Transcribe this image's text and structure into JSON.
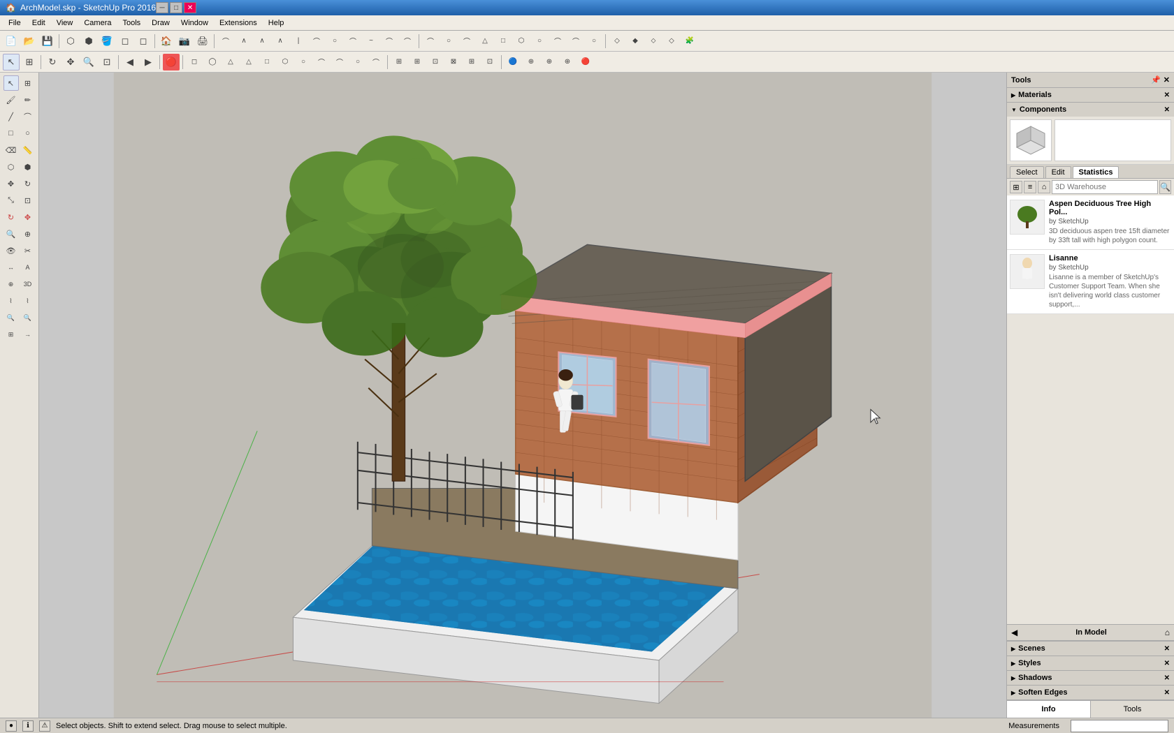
{
  "titlebar": {
    "title": "ArchModel.skp - SketchUp Pro 2016",
    "controls": [
      "minimize",
      "maximize",
      "close"
    ]
  },
  "menubar": {
    "items": [
      "File",
      "Edit",
      "View",
      "Camera",
      "Tools",
      "Draw",
      "Window",
      "Extensions",
      "Help"
    ]
  },
  "panels": {
    "tools_label": "Tools",
    "materials_label": "Materials",
    "components_label": "Components",
    "scenes_label": "Scenes",
    "styles_label": "Styles",
    "shadows_label": "Shadows",
    "soften_edges_label": "Soften Edges"
  },
  "components": {
    "tabs": {
      "select_label": "Select",
      "edit_label": "Edit",
      "statistics_label": "Statistics"
    },
    "search_placeholder": "3D Warehouse",
    "in_model_label": "In Model",
    "items": [
      {
        "name": "Aspen Deciduous Tree High Pol...",
        "by": "by SketchUp",
        "desc": "3D deciduous aspen tree 15ft diameter by 33ft tall with high polygon count."
      },
      {
        "name": "Lisanne",
        "by": "by SketchUp",
        "desc": "Lisanne is a member of SketchUp's Customer Support Team. When she isn't delivering world class customer support,..."
      }
    ]
  },
  "statusbar": {
    "message": "Select objects. Shift to extend select. Drag mouse to select multiple.",
    "measurements_label": "Measurements"
  },
  "bottom_tabs": {
    "info_label": "Info",
    "tools_label": "Tools"
  },
  "icons": {
    "arrow_right": "▶",
    "arrow_down": "▼",
    "search": "🔍",
    "home": "⌂",
    "close_x": "✕",
    "grid": "⊞",
    "list": "≡",
    "cursor": "↖",
    "pencil": "✏",
    "eraser": "⌫",
    "paint": "🖌",
    "zoom_in": "+",
    "zoom_out": "-",
    "rotate": "↻",
    "move": "✥"
  }
}
